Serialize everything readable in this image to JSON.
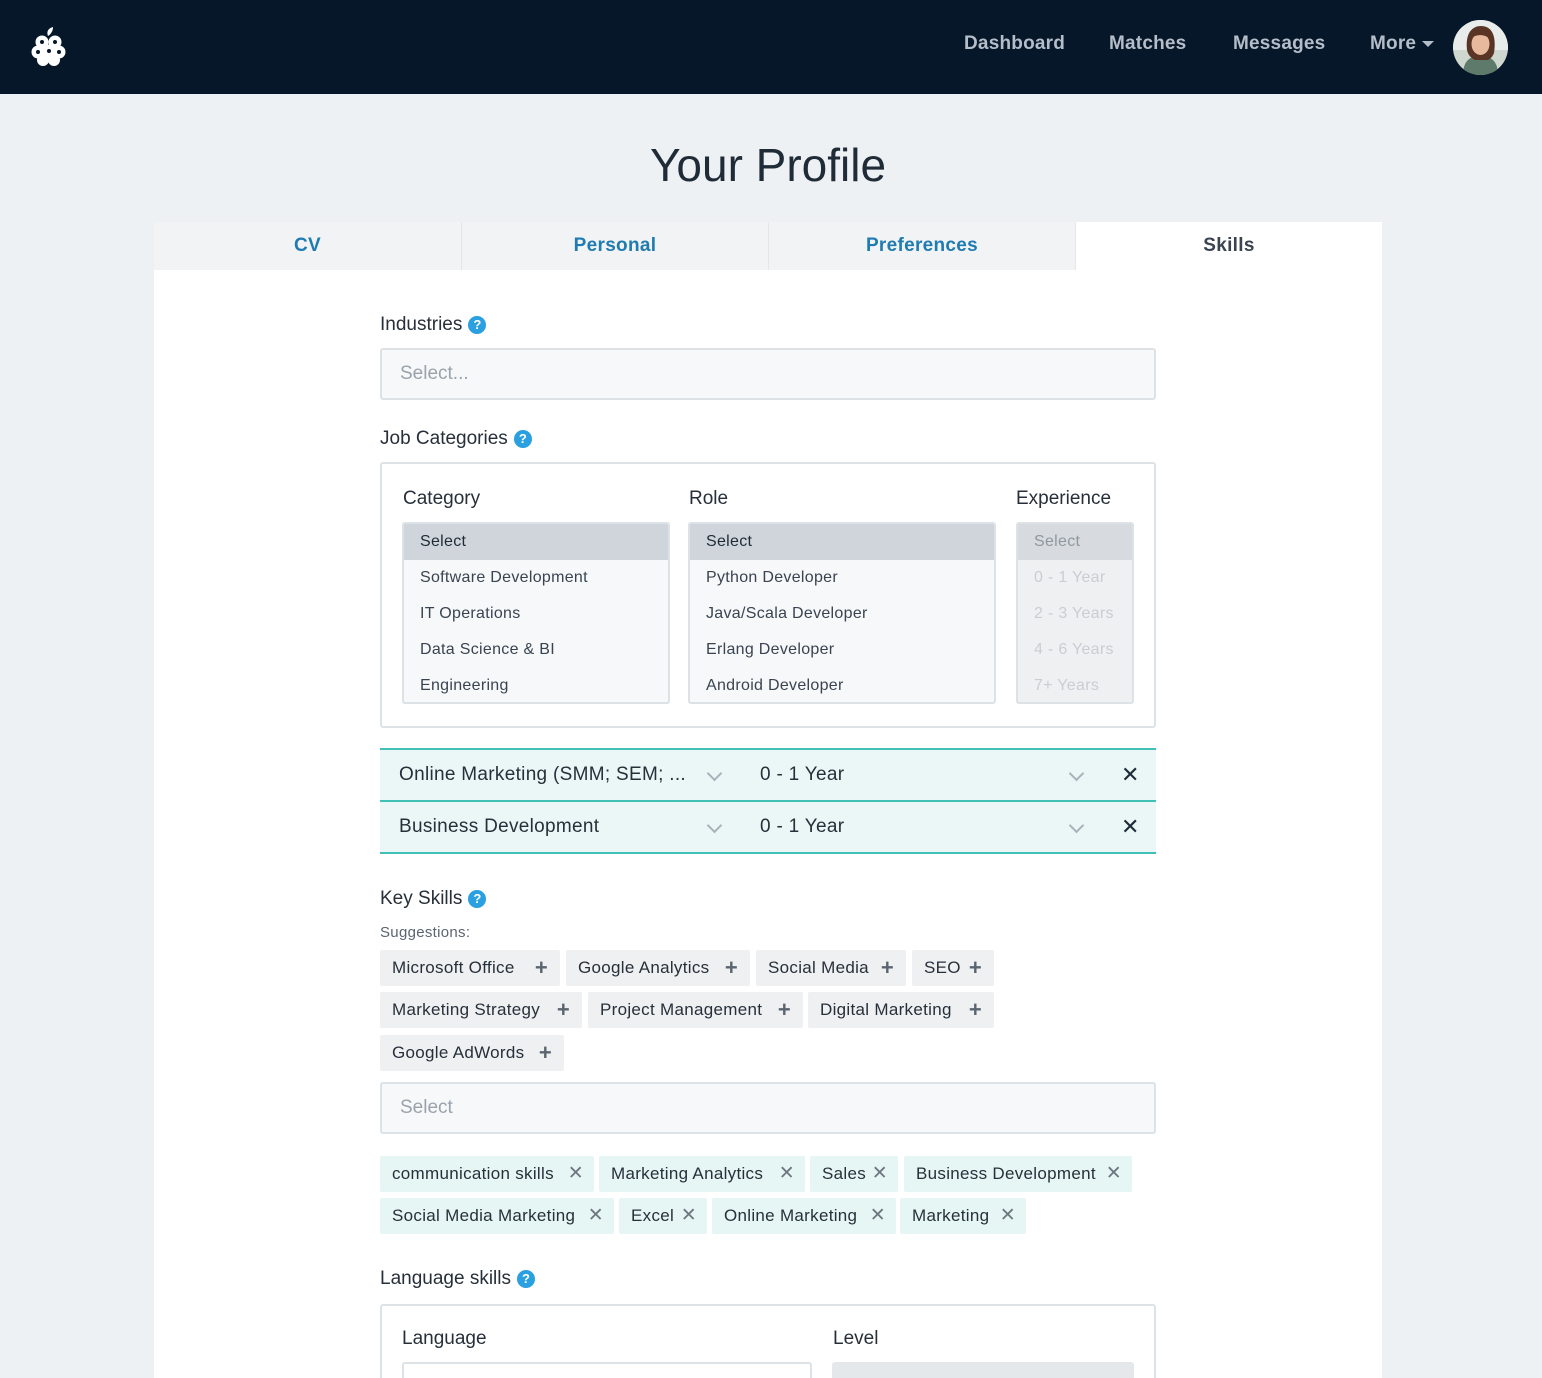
{
  "nav": {
    "logo_icon": "raspberry-logo-icon",
    "links": [
      "Dashboard",
      "Matches",
      "Messages",
      "More"
    ],
    "avatar_icon": "user-avatar"
  },
  "page": {
    "title": "Your Profile"
  },
  "tabs": [
    {
      "label": "CV",
      "active": false
    },
    {
      "label": "Personal",
      "active": false
    },
    {
      "label": "Preferences",
      "active": false
    },
    {
      "label": "Skills",
      "active": true
    }
  ],
  "industries": {
    "label": "Industries",
    "placeholder": "Select..."
  },
  "job_categories": {
    "label": "Job Categories",
    "category": {
      "heading": "Category",
      "options": [
        "Select",
        "Software Development",
        "IT Operations",
        "Data Science & BI",
        "Engineering"
      ]
    },
    "role": {
      "heading": "Role",
      "options": [
        "Select",
        "Python Developer",
        "Java/Scala Developer",
        "Erlang Developer",
        "Android Developer"
      ]
    },
    "experience": {
      "heading": "Experience",
      "options": [
        "Select",
        "0 - 1 Year",
        "2 - 3 Years",
        "4 - 6 Years",
        "7+ Years"
      ]
    },
    "selected": [
      {
        "category": "Online Marketing (SMM; SEM; ...",
        "experience": "0 - 1 Year"
      },
      {
        "category": "Business Development",
        "experience": "0 - 1 Year"
      }
    ]
  },
  "key_skills": {
    "label": "Key Skills",
    "suggestions_label": "Suggestions:",
    "suggestions": [
      "Microsoft Office",
      "Google Analytics",
      "Social Media",
      "SEO",
      "Marketing Strategy",
      "Project Management",
      "Digital Marketing",
      "Google AdWords"
    ],
    "select_placeholder": "Select",
    "selected": [
      "communication skills",
      "Marketing Analytics",
      "Sales",
      "Business Development",
      "Social Media Marketing",
      "Excel",
      "Online Marketing",
      "Marketing"
    ]
  },
  "language_skills": {
    "label": "Language skills",
    "language_heading": "Language",
    "level_heading": "Level"
  },
  "colors": {
    "nav_bg": "#06172a",
    "link": "#1f7bb0",
    "accent_teal": "#3fc1b6",
    "help_blue": "#2ba0e0"
  }
}
